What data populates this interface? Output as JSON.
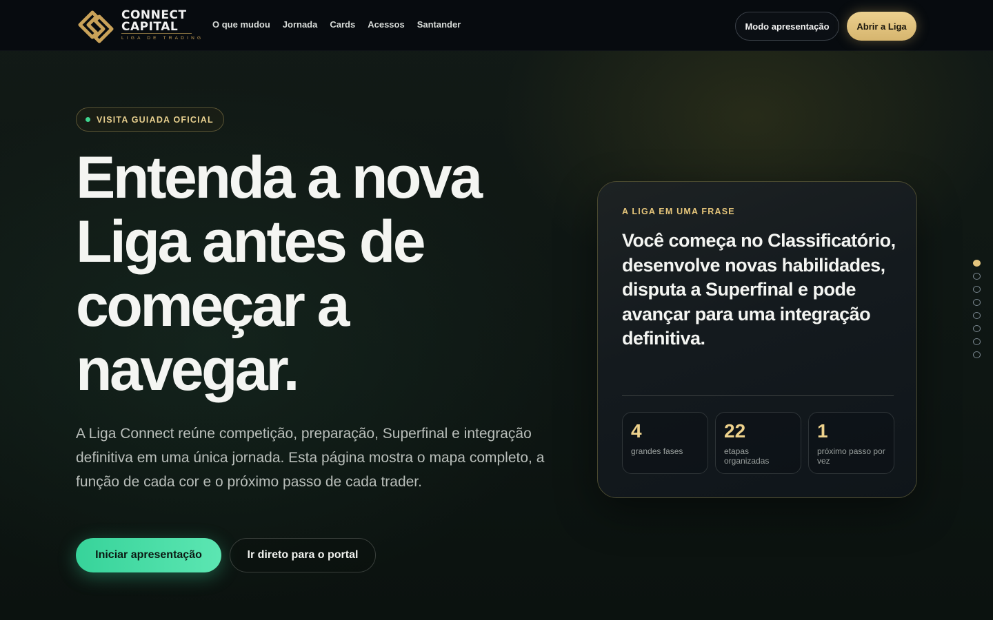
{
  "brand": {
    "name_line1": "CONNECT",
    "name_line2": "CAPITAL",
    "tagline": "LIGA DE TRADING",
    "gold": "#c9a259"
  },
  "nav": {
    "links": [
      "O que mudou",
      "Jornada",
      "Cards",
      "Acessos",
      "Santander"
    ],
    "present_button": "Modo apresentação",
    "open_button": "Abrir a Liga"
  },
  "hero": {
    "badge": "VISITA GUIADA OFICIAL",
    "title_lines": [
      "Entenda a nova",
      "Liga antes de",
      "começar a",
      "navegar."
    ],
    "description": "A Liga Connect reúne competição, preparação, Superfinal e integração definitiva em uma única jornada. Esta página mostra o mapa completo, a função de cada cor e o próximo passo de cada trader.",
    "primary_button": "Iniciar apresentação",
    "secondary_button": "Ir direto para o portal",
    "accent_green": "#3fd58f"
  },
  "card": {
    "kicker": "A LIGA EM UMA FRASE",
    "quote": "Você começa no Classificatório, desenvolve novas habilidades, disputa a Superfinal e pode avançar para uma integração definitiva.",
    "stats": [
      {
        "value": "4",
        "label": "grandes fases"
      },
      {
        "value": "22",
        "label": "etapas organizadas"
      },
      {
        "value": "1",
        "label": "próximo passo por vez"
      }
    ]
  },
  "section_dots": {
    "count": 8,
    "active_index": 0
  }
}
